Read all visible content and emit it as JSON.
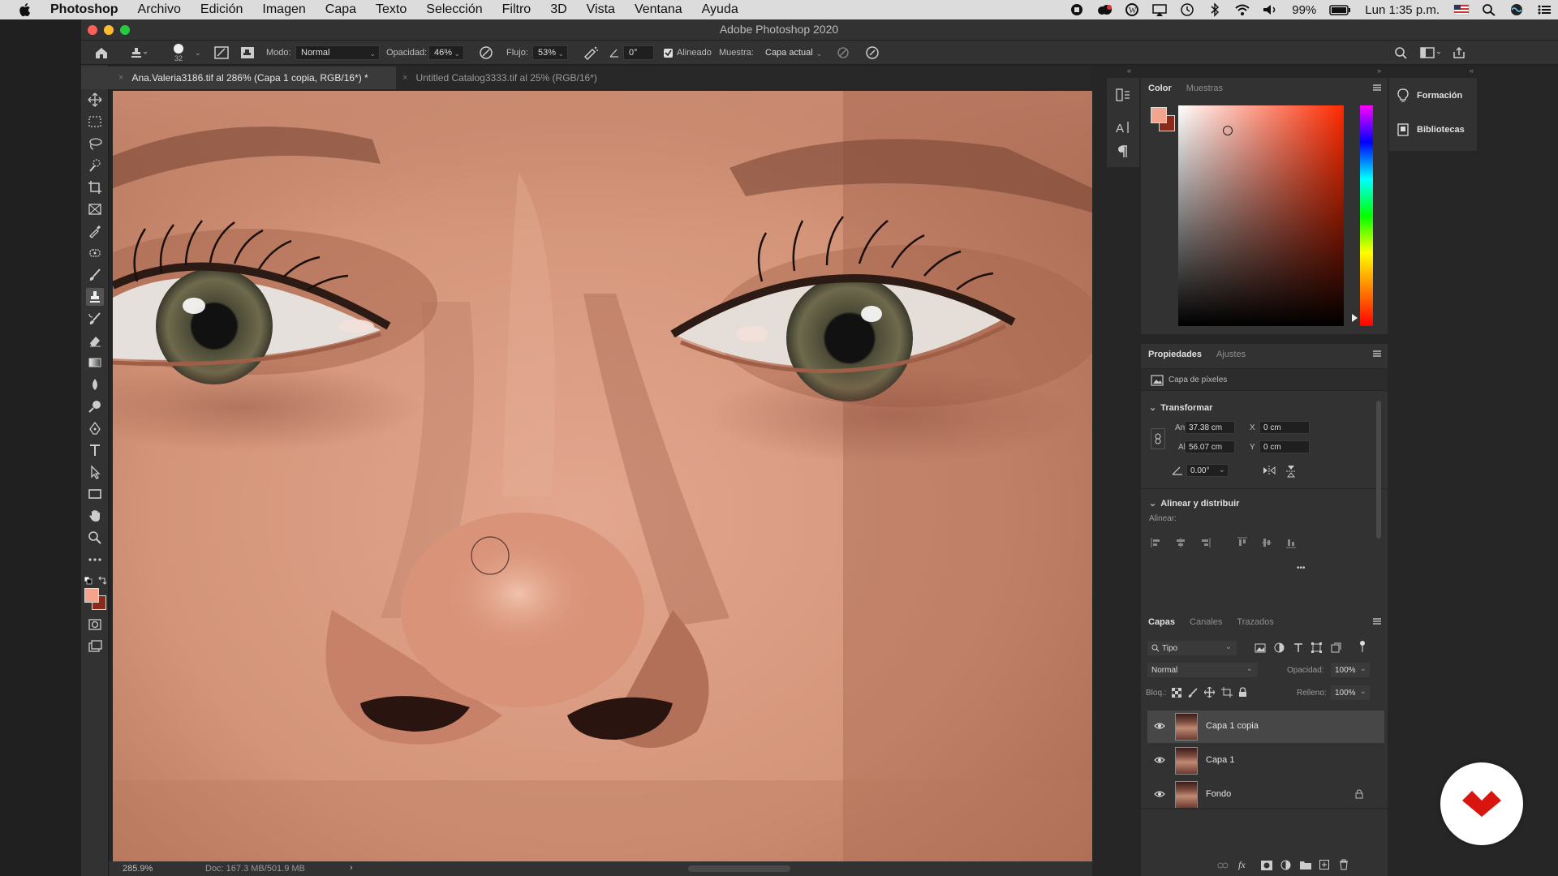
{
  "menubar": {
    "app": "Photoshop",
    "items": [
      "Archivo",
      "Edición",
      "Imagen",
      "Capa",
      "Texto",
      "Selección",
      "Filtro",
      "3D",
      "Vista",
      "Ventana",
      "Ayuda"
    ],
    "battery": "99%",
    "clock": "Lun 1:35 p.m."
  },
  "window": {
    "title": "Adobe Photoshop 2020"
  },
  "options": {
    "brush_size": "32",
    "mode_label": "Modo:",
    "mode_value": "Normal",
    "opacity_label": "Opacidad:",
    "opacity_value": "46%",
    "flow_label": "Flujo:",
    "flow_value": "53%",
    "angle_value": "0°",
    "aligned_label": "Alineado",
    "sample_label": "Muestra:",
    "sample_value": "Capa actual"
  },
  "tabs": [
    {
      "label": "Ana.Valeria3186.tif al 286% (Capa 1 copia, RGB/16*) *",
      "active": true
    },
    {
      "label": "Untitled Catalog3333.tif al 25% (RGB/16*)",
      "active": false
    }
  ],
  "status": {
    "zoom": "285.9%",
    "doc": "Doc: 167.3 MB/501.9 MB",
    "arrow": "›"
  },
  "color_panel": {
    "tabs": [
      "Color",
      "Muestras"
    ],
    "foreground": "#f2a48c",
    "background": "#8a2a1a"
  },
  "properties_panel": {
    "tabs": [
      "Propiedades",
      "Ajustes"
    ],
    "kind": "Capa de píxeles",
    "transform_title": "Transformar",
    "w_label": "An",
    "w_value": "37.38 cm",
    "x_label": "X",
    "x_value": "0 cm",
    "h_label": "Al",
    "h_value": "56.07 cm",
    "y_label": "Y",
    "y_value": "0 cm",
    "angle_value": "0.00°",
    "align_title": "Alinear y distribuir",
    "align_label": "Alinear:",
    "more": "•••"
  },
  "layers_panel": {
    "tabs": [
      "Capas",
      "Canales",
      "Trazados"
    ],
    "filter": "Tipo",
    "blend": "Normal",
    "opacity_label": "Opacidad:",
    "opacity_value": "100%",
    "lock_label": "Bloq.:",
    "fill_label": "Relleno:",
    "fill_value": "100%",
    "layers": [
      {
        "name": "Capa 1 copia",
        "selected": true,
        "locked": false
      },
      {
        "name": "Capa 1",
        "selected": false,
        "locked": false
      },
      {
        "name": "Fondo",
        "selected": false,
        "locked": true
      }
    ]
  },
  "side_panels": [
    {
      "label": "Formación",
      "icon": "lightbulb-icon"
    },
    {
      "label": "Bibliotecas",
      "icon": "library-icon"
    }
  ]
}
